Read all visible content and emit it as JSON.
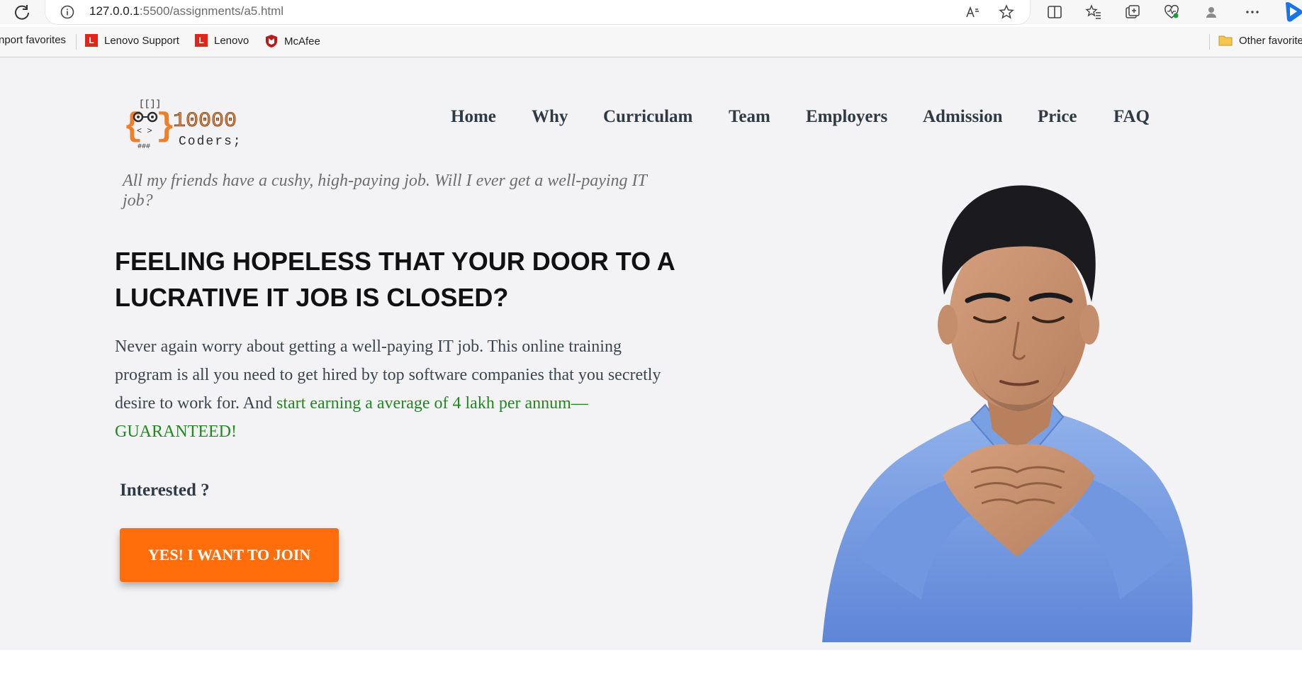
{
  "browser": {
    "url_host": "127.0.0.1",
    "url_rest": ":5500/assignments/a5.html",
    "bookmarks": [
      "nport favorites",
      "Lenovo Support",
      "Lenovo",
      "McAfee"
    ],
    "other_favorites": "Other favorite",
    "bookmark_logo_letter": "L"
  },
  "logo": {
    "number": "10000",
    "word": "Coders;"
  },
  "nav": [
    "Home",
    "Why",
    "Curriculam",
    "Team",
    "Employers",
    "Admission",
    "Price",
    "FAQ"
  ],
  "hero": {
    "tagline": "All my friends have a cushy, high-paying job. Will I ever get a well-paying IT job?",
    "headline": "FEELING HOPELESS THAT YOUR DOOR TO A LUCRATIVE IT JOB IS CLOSED?",
    "body_main": "Never again worry about getting a well-paying IT job. This online training program is all you need to get hired by top software companies that you secretly desire to work for. And ",
    "body_highlight": "start earning a average of 4 lakh per annum—GUARANTEED!",
    "interested": "Interested ?",
    "cta": "YES! I WANT TO JOIN"
  },
  "colors": {
    "page_bg": "#f3f3f5",
    "cta": "#ff6e0a",
    "highlight": "#1e8a1e",
    "nav": "#2f3a44",
    "logo_orange": "#f07f2a"
  }
}
